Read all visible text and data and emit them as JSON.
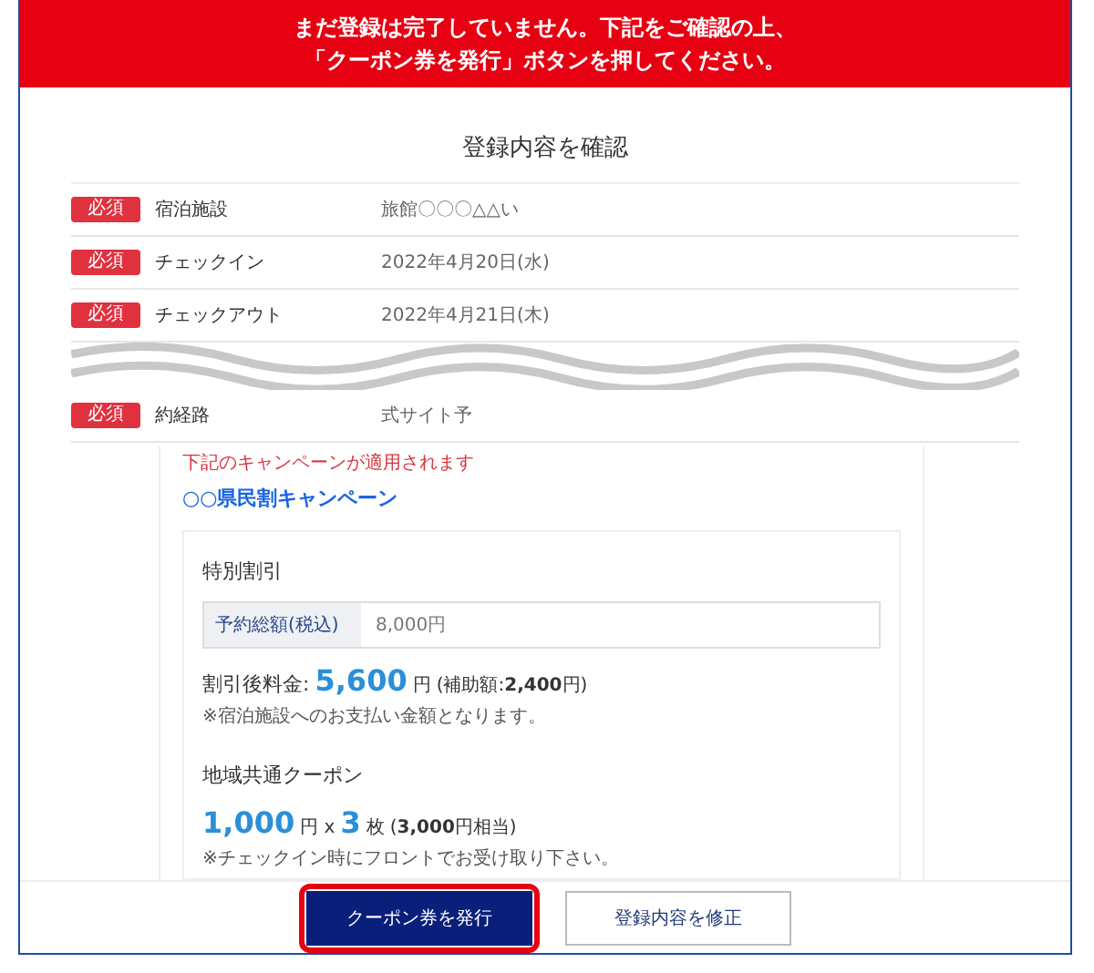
{
  "banner": {
    "lines": [
      "まだ登録は完了していません。下記をご確認の上、",
      "「クーポン券を発行」ボタンを押してください。"
    ]
  },
  "title": "登録内容を確認",
  "rows": [
    {
      "badge": "必須",
      "label": "宿泊施設",
      "value": "旅館〇〇〇△△い"
    },
    {
      "badge": "必須",
      "label": "チェックイン",
      "value": "2022年4月20日(水)"
    },
    {
      "badge": "必須",
      "label": "チェックアウト",
      "value": "2022年4月21日(木)"
    },
    {
      "badge": "必須",
      "label": "約経路",
      "value": "式サイト予"
    }
  ],
  "campaign": {
    "notice": "下記のキャンペーンが適用されます",
    "name": "○○県民割キャンペーン"
  },
  "discount": {
    "heading": "特別割引",
    "field_label": "予約総額(税込)",
    "field_value": "8,000円",
    "price_label": "割引後料金:",
    "price": "5,600",
    "price_unit": "円",
    "subsidy": "(補助額:**2,400**円)",
    "note": "※宿泊施設へのお支払い金額となります。"
  },
  "coupon": {
    "heading": "地域共通クーポン",
    "amount": "1,000",
    "unit": "円 x",
    "count": "3",
    "count_unit": "枚",
    "equivalent": "(**3,000**円相当)",
    "note": "※チェックイン時にフロントでお受け取り下さい。"
  },
  "buttons": [
    {
      "label": "クーポン券を発行",
      "kind": "primary",
      "highlighted": true
    },
    {
      "label": "登録内容を修正",
      "kind": "secondary",
      "highlighted": false
    }
  ]
}
